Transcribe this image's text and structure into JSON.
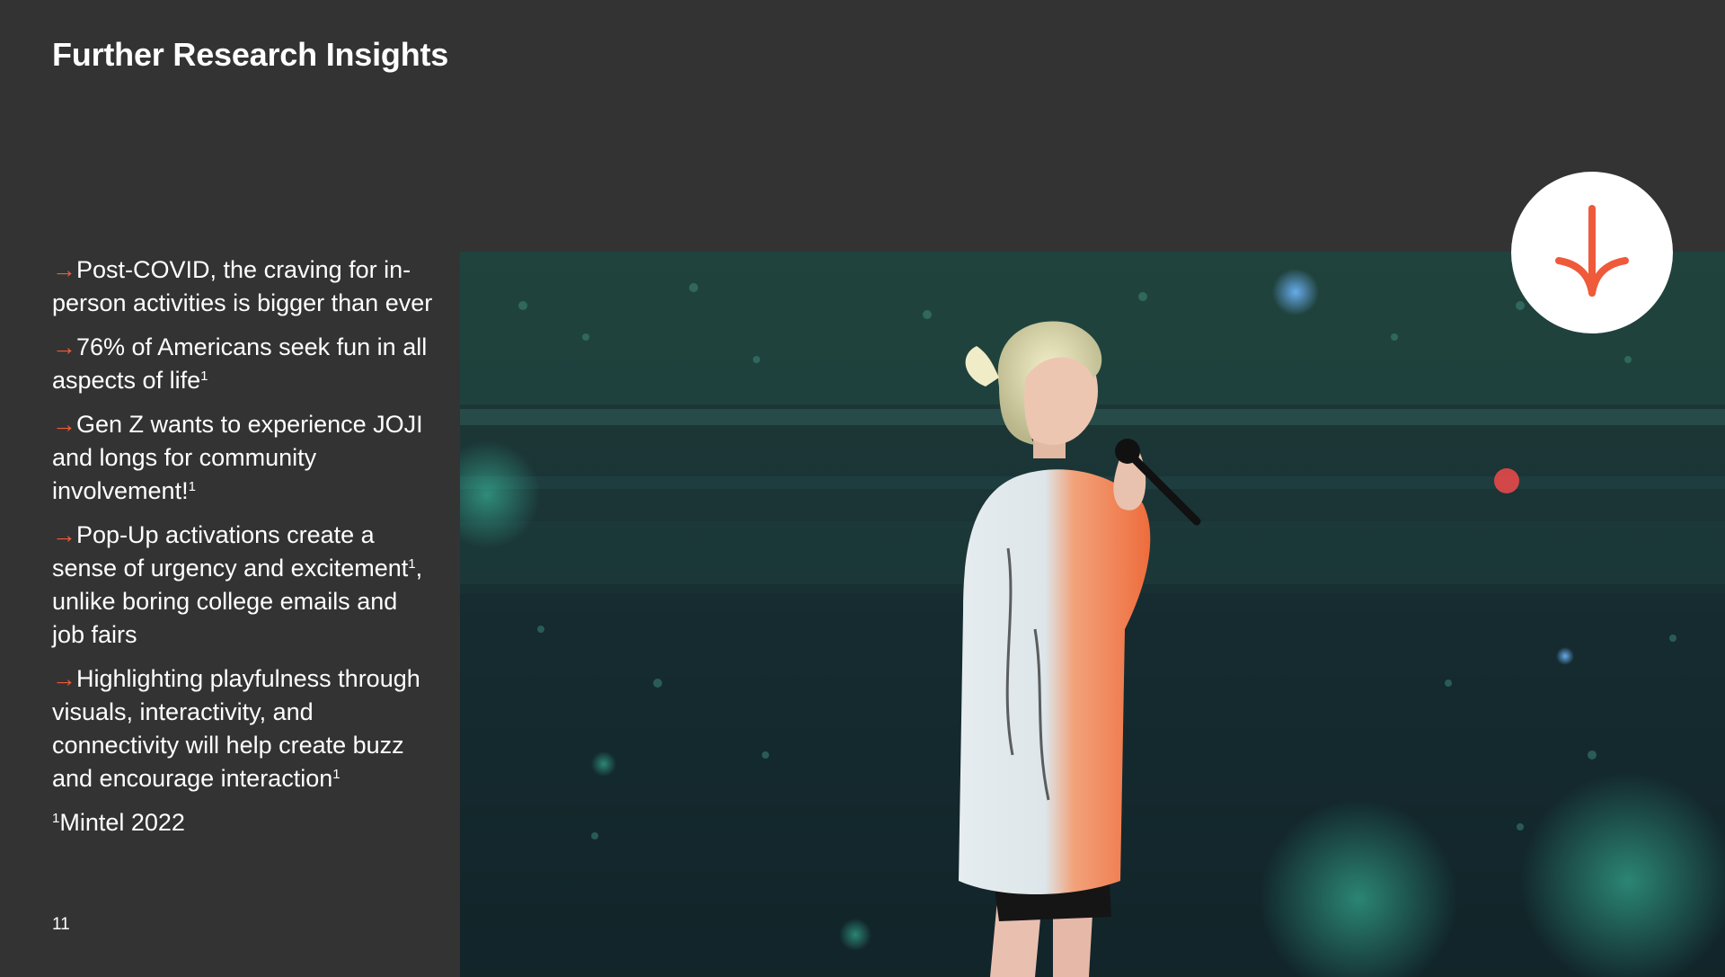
{
  "slide": {
    "title": "Further Research Insights",
    "page_number": "11"
  },
  "bullets": [
    {
      "arrow": "→",
      "text": "Post-COVID, the craving for in-person activities is bigger than ever",
      "sup": ""
    },
    {
      "arrow": "→",
      "text": "76% of Americans seek fun in all aspects of life",
      "sup": "1"
    },
    {
      "arrow": "→",
      "text": "Gen Z wants to experience JOJI and longs for community involvement!",
      "sup": "1"
    },
    {
      "arrow": "→",
      "text_before": "Pop-Up activations create a sense of urgency and excitement",
      "sup": "1",
      "text_after": ", unlike boring college emails and job fairs"
    },
    {
      "arrow": "→",
      "text": "Highlighting playfulness through visuals, interactivity, and connectivity will help create buzz and encourage interaction",
      "sup": "1"
    }
  ],
  "source": {
    "sup": "1",
    "text": "Mintel 2022"
  },
  "icons": {
    "badge_icon": "arrow-down-icon",
    "photo": "concert-performer-photo"
  },
  "colors": {
    "background": "#333333",
    "accent": "#ee5a3a",
    "text": "#ffffff"
  }
}
